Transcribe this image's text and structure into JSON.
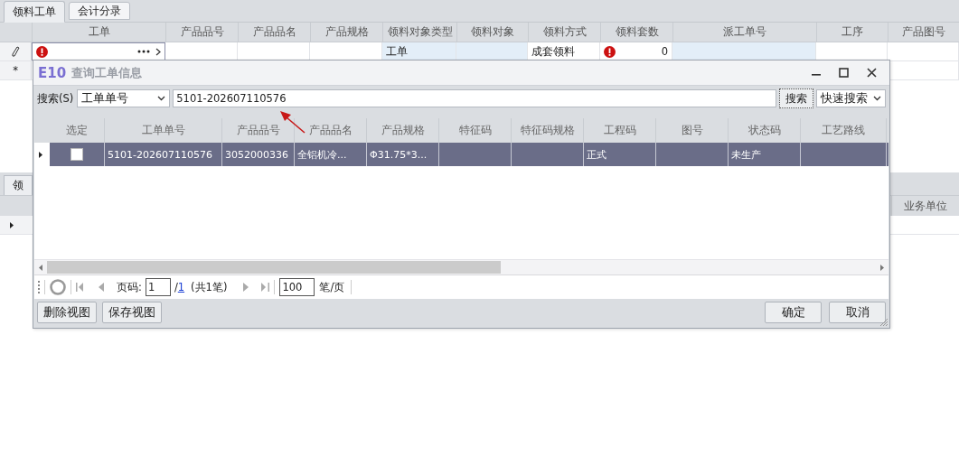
{
  "tabs": [
    {
      "label": "领料工单",
      "selected": true
    },
    {
      "label": "会计分录",
      "selected": false
    }
  ],
  "grid": {
    "columns": [
      "工单",
      "产品品号",
      "产品品名",
      "产品规格",
      "领料对象类型",
      "领料对象",
      "领料方式",
      "领料套数",
      "派工单号",
      "工序",
      "产品图号"
    ],
    "rows": [
      {
        "kind": "editing",
        "cells": [
          {
            "error": true,
            "lookup": true
          },
          {},
          {},
          {},
          {
            "text": "工单",
            "readonly": true
          },
          {
            "readonly": true
          },
          {
            "text": "成套领料"
          },
          {
            "error": true,
            "text": "0",
            "numeric": true
          },
          {
            "readonly": true
          },
          {},
          {}
        ]
      },
      {
        "kind": "new",
        "marker": "*"
      }
    ]
  },
  "lower_panel": {
    "tab": "领",
    "columns": [
      "业务单位"
    ]
  },
  "dialog": {
    "logo": "E10",
    "title": "查询工单信息",
    "search": {
      "label": "搜索(S)",
      "field": "工单单号",
      "value": "5101-202607110576",
      "button": "搜索",
      "mode": "快速搜索"
    },
    "columns": [
      "选定",
      "工单单号",
      "产品品号",
      "产品品名",
      "产品规格",
      "特征码",
      "特征码规格",
      "工程码",
      "图号",
      "状态码",
      "工艺路线"
    ],
    "rows": [
      {
        "selected": true,
        "checked": false,
        "cells": [
          "",
          "5101-202607110576",
          "3052000336",
          "全铝机冷...",
          "Φ31.75*3...",
          "",
          "",
          "正式",
          "",
          "未生产",
          ""
        ]
      }
    ],
    "pager": {
      "page_label": "页码:",
      "page": "1",
      "separator": "/",
      "total_pages": "1",
      "count": "(共1笔)",
      "page_size": "100",
      "unit": "笔/页"
    },
    "buttons_left": [
      "删除视图",
      "保存视图"
    ],
    "buttons_right": [
      "确定",
      "取消"
    ]
  }
}
